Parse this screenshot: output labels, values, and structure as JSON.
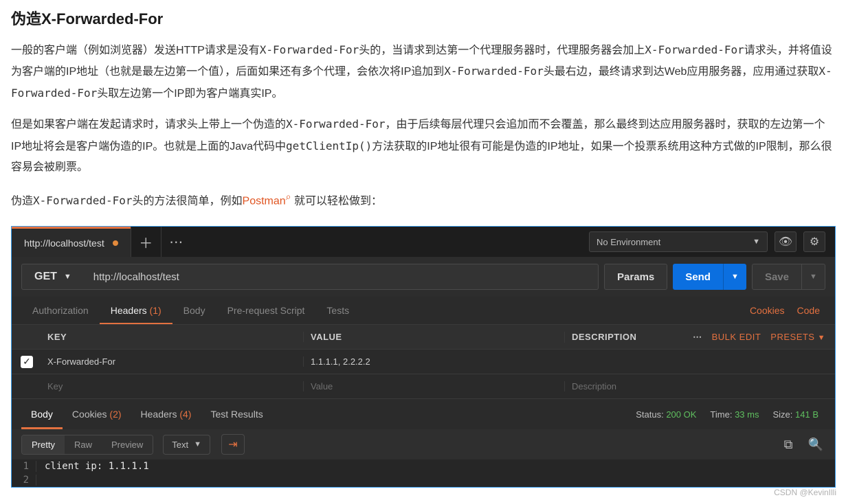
{
  "article": {
    "title": "伪造X-Forwarded-For",
    "p1_a": "一般的客户端（例如浏览器）发送HTTP请求是没有",
    "xff": "X-Forwarded-For",
    "p1_b": "头的，当请求到达第一个代理服务器时，代理服务器会加上",
    "p1_c": "请求头，并将值设为客户端的IP地址（也就是最左边第一个值），后面如果还有多个代理，会依次将IP追加到",
    "p1_d": "头最右边，最终请求到达Web应用服务器，应用通过获取",
    "p1_e": "头取左边第一个IP即为客户端真实IP。",
    "p2_a": "但是如果客户端在发起请求时，请求头上带上一个伪造的",
    "p2_b": "，由于后续每层代理只会追加而不会覆盖，那么最终到达应用服务器时，获取的左边第一个IP地址将会是客户端伪造的IP。也就是上面的Java代码中",
    "code_fn": "getClientIp()",
    "p2_c": "方法获取的IP地址很有可能是伪造的IP地址，如果一个投票系统用这种方式做的IP限制，那么很容易会被刷票。",
    "p3_a": "伪造",
    "p3_b": "头的方法很简单，例如",
    "link": "Postman",
    "p3_c": "就可以轻松做到："
  },
  "postman": {
    "tab_title": "http://localhost/test",
    "env": "No Environment",
    "method": "GET",
    "url": "http://localhost/test",
    "params": "Params",
    "send": "Send",
    "save": "Save",
    "subtabs": {
      "auth": "Authorization",
      "headers": "Headers",
      "headers_count": "(1)",
      "body": "Body",
      "pre": "Pre-request Script",
      "tests": "Tests"
    },
    "links": {
      "cookies": "Cookies",
      "code": "Code"
    },
    "table": {
      "h_key": "KEY",
      "h_val": "VALUE",
      "h_desc": "DESCRIPTION",
      "bulk": "Bulk Edit",
      "presets": "Presets",
      "row_key": "X-Forwarded-For",
      "row_val": "1.1.1.1, 2.2.2.2",
      "ph_key": "Key",
      "ph_val": "Value",
      "ph_desc": "Description"
    },
    "resp": {
      "body": "Body",
      "cookies": "Cookies",
      "cookies_n": "(2)",
      "headers": "Headers",
      "headers_n": "(4)",
      "tests": "Test Results",
      "status_lbl": "Status:",
      "status_val": "200 OK",
      "time_lbl": "Time:",
      "time_val": "33 ms",
      "size_lbl": "Size:",
      "size_val": "141 B"
    },
    "view": {
      "pretty": "Pretty",
      "raw": "Raw",
      "preview": "Preview",
      "type": "Text"
    },
    "code_lines": {
      "l1n": "1",
      "l1": "client ip: 1.1.1.1",
      "l2n": "2"
    }
  },
  "watermark": "CSDN @KevinIlli"
}
